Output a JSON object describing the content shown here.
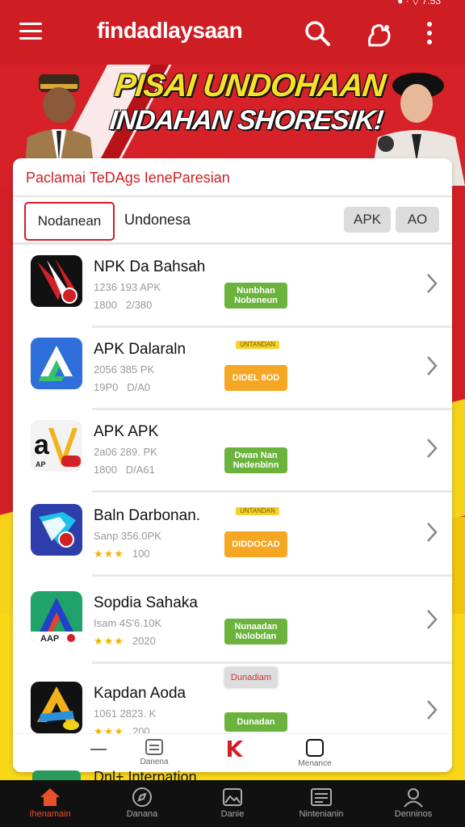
{
  "app": {
    "title": "findadlaysaan",
    "status_text": "● · ▽ 7:53"
  },
  "banner": {
    "line1": "PISAI UNDOHAAN",
    "line2": "INDAHAN SHORESIK!"
  },
  "card": {
    "heading": "Paclamai TeDAgs IeneParesian",
    "filter_active": "Nodanean",
    "filter_second": "Undonesa",
    "chip_apk": "APK",
    "chip_ao": "AO"
  },
  "items": [
    {
      "name": "NPK Da Bahsah",
      "meta1": "1236 193 APK",
      "meta2a": "1800",
      "meta2b": "2/380",
      "button": "Nunbhan\nNobeneun",
      "button_color": "green",
      "tag": ""
    },
    {
      "name": "APK Dalaraln",
      "meta1": "2056 385 PK",
      "meta2a": "19P0",
      "meta2b": "D/A0",
      "button": "DIDEL 8OD",
      "button_color": "orange",
      "tag": "UNTANDAN"
    },
    {
      "name": "APK  APK",
      "meta1": "2a06 289. PK",
      "meta2a": "1800",
      "meta2b": "D/A61",
      "button": "Dwan Nan\nNedenbinn",
      "button_color": "green",
      "tag": ""
    },
    {
      "name": "Baln Darbonan.",
      "meta1": "Sanp 356.0PK",
      "meta2a": "★★★",
      "meta2b": "100",
      "button": "DIDDOCAD",
      "button_color": "orange",
      "tag": "UNTANDAN"
    },
    {
      "name": "Sopdia Sahaka",
      "meta1": "Isam 4S'6.10K",
      "meta2a": "★★★",
      "meta2b": "2020",
      "button": "Nunaadan\nNolobdan",
      "button_color": "green",
      "tag": ""
    },
    {
      "name": "Kapdan Aoda",
      "meta1": "1061 2823. K",
      "meta2a": "★★★",
      "meta2b": "200",
      "button": "Dunadan",
      "button_color": "green",
      "tag": "",
      "pill": "Dunadiam"
    }
  ],
  "minibar": {
    "item2": "Danena",
    "item4": "Menance"
  },
  "peek_text": "Dnl+ Internation",
  "bottom_nav": [
    {
      "label": "Ihenamain",
      "active": true
    },
    {
      "label": "Danana",
      "active": false
    },
    {
      "label": "Danie",
      "active": false
    },
    {
      "label": "Nintenianin",
      "active": false
    },
    {
      "label": "Denninos",
      "active": false
    }
  ],
  "colors": {
    "brand_red": "#cf1d24",
    "accent_yellow": "#f6d21b",
    "button_green": "#6bb33c",
    "button_orange": "#f5a623",
    "active_nav": "#e8512a"
  }
}
